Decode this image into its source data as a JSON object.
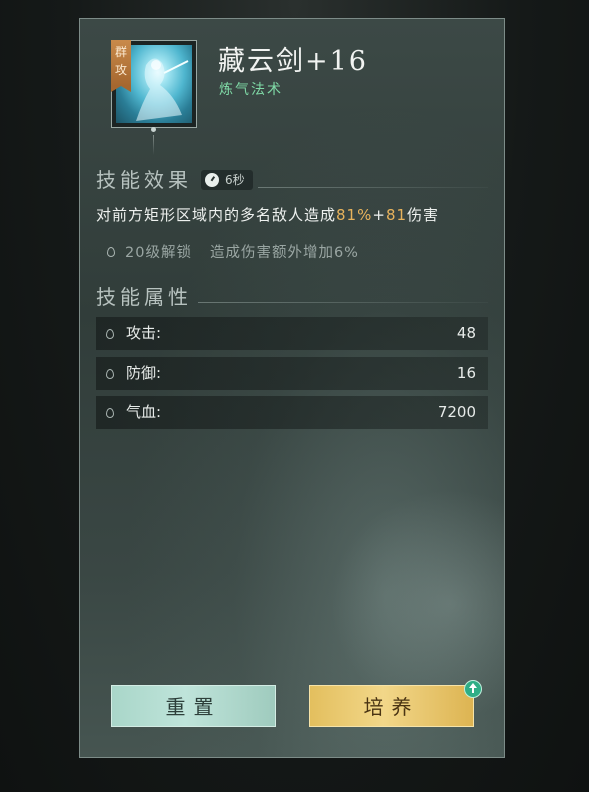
{
  "skill": {
    "tag": "群攻",
    "name": "藏云剑+16",
    "type": "炼气法术"
  },
  "effect": {
    "title": "技能效果",
    "cooldown": "6秒",
    "desc_prefix": "对前方矩形区域内的多名敌人造成",
    "desc_pct": "81%",
    "desc_plus": "+",
    "desc_flat": "81",
    "desc_suffix": "伤害",
    "unlock_level": "20级解锁",
    "unlock_effect": "造成伤害额外增加6%"
  },
  "attributes": {
    "title": "技能属性",
    "rows": [
      {
        "label": "攻击:",
        "value": "48"
      },
      {
        "label": "防御:",
        "value": "16"
      },
      {
        "label": "气血:",
        "value": "7200"
      }
    ]
  },
  "buttons": {
    "reset": "重置",
    "train": "培养"
  },
  "colors": {
    "highlight": "#e8b35c",
    "skill_type": "#7fd9a6",
    "train_button": "#f2d789",
    "reset_button": "#bfe4da"
  },
  "icons": [
    "cooldown-clock-icon",
    "bullet-drop-icon",
    "upgrade-arrow-icon"
  ]
}
